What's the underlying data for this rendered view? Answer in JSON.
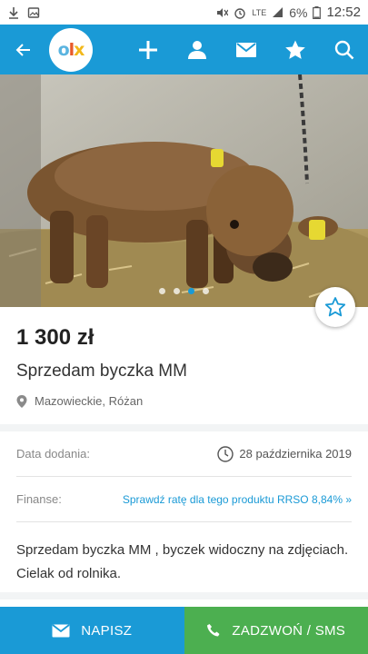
{
  "status_bar": {
    "time": "12:52",
    "battery": "6%",
    "network": "LTE",
    "icons": [
      "download-icon",
      "gallery-icon",
      "mute-icon",
      "alarm-icon",
      "signal-icon",
      "battery-icon"
    ]
  },
  "app_bar": {
    "logo_text": [
      "o",
      "l",
      "x"
    ],
    "icons": [
      "back-arrow-icon",
      "plus-icon",
      "user-icon",
      "mail-icon",
      "star-icon",
      "search-icon"
    ]
  },
  "gallery": {
    "page_count": 4,
    "current_page": 3
  },
  "listing": {
    "price": "1 300 zł",
    "title": "Sprzedam byczka MM",
    "location": "Mazowieckie, Różan"
  },
  "details": {
    "date_label": "Data dodania:",
    "date_value": "28 października 2019",
    "finance_label": "Finanse:",
    "finance_link": "Sprawdź ratę dla tego produktu RRSO 8,84% »"
  },
  "description": "Sprzedam byczka MM , byczek widoczny na zdjęciach. Cielak od rolnika.",
  "actions": {
    "message_label": "NAPISZ",
    "call_label": "ZADZWOŃ / SMS"
  },
  "colors": {
    "brand_blue": "#1a9ad6",
    "call_green": "#4caf50"
  }
}
